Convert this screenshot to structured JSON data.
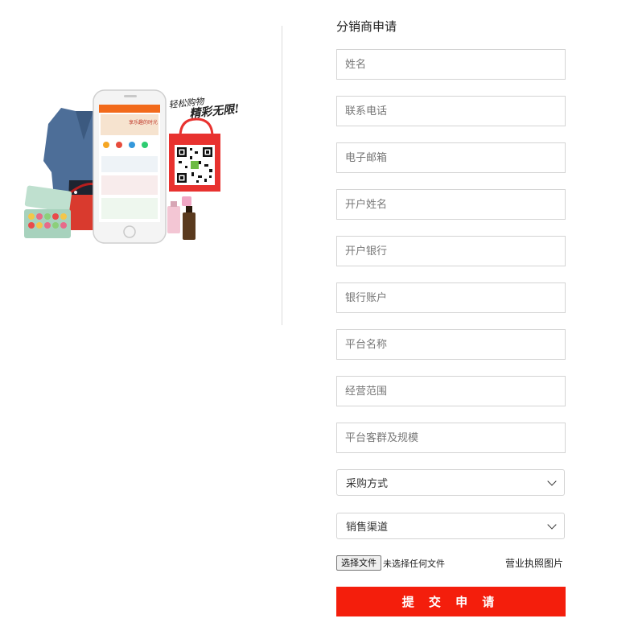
{
  "form": {
    "title": "分销商申请",
    "fields": [
      {
        "placeholder": "姓名"
      },
      {
        "placeholder": "联系电话"
      },
      {
        "placeholder": "电子邮箱"
      },
      {
        "placeholder": "开户姓名"
      },
      {
        "placeholder": "开户银行"
      },
      {
        "placeholder": "银行账户"
      },
      {
        "placeholder": "平台名称"
      },
      {
        "placeholder": "经营范围"
      },
      {
        "placeholder": "平台客群及规模"
      }
    ],
    "selects": [
      {
        "selected": "采购方式"
      },
      {
        "selected": "销售渠道"
      }
    ],
    "upload": {
      "button_label": "选择文件",
      "status": "未选择任何文件",
      "label": "营业执照图片"
    },
    "submit_label": "提 交 申 请"
  },
  "promo": {
    "slogan_line1": "轻松购物",
    "slogan_line2": "精彩无限!",
    "phone_banner": "享乐趣的时光"
  },
  "colors": {
    "accent": "#f41e0c",
    "border": "#d4d4d4",
    "phone_header": "#f26a1b",
    "bag": "#e8322f"
  }
}
